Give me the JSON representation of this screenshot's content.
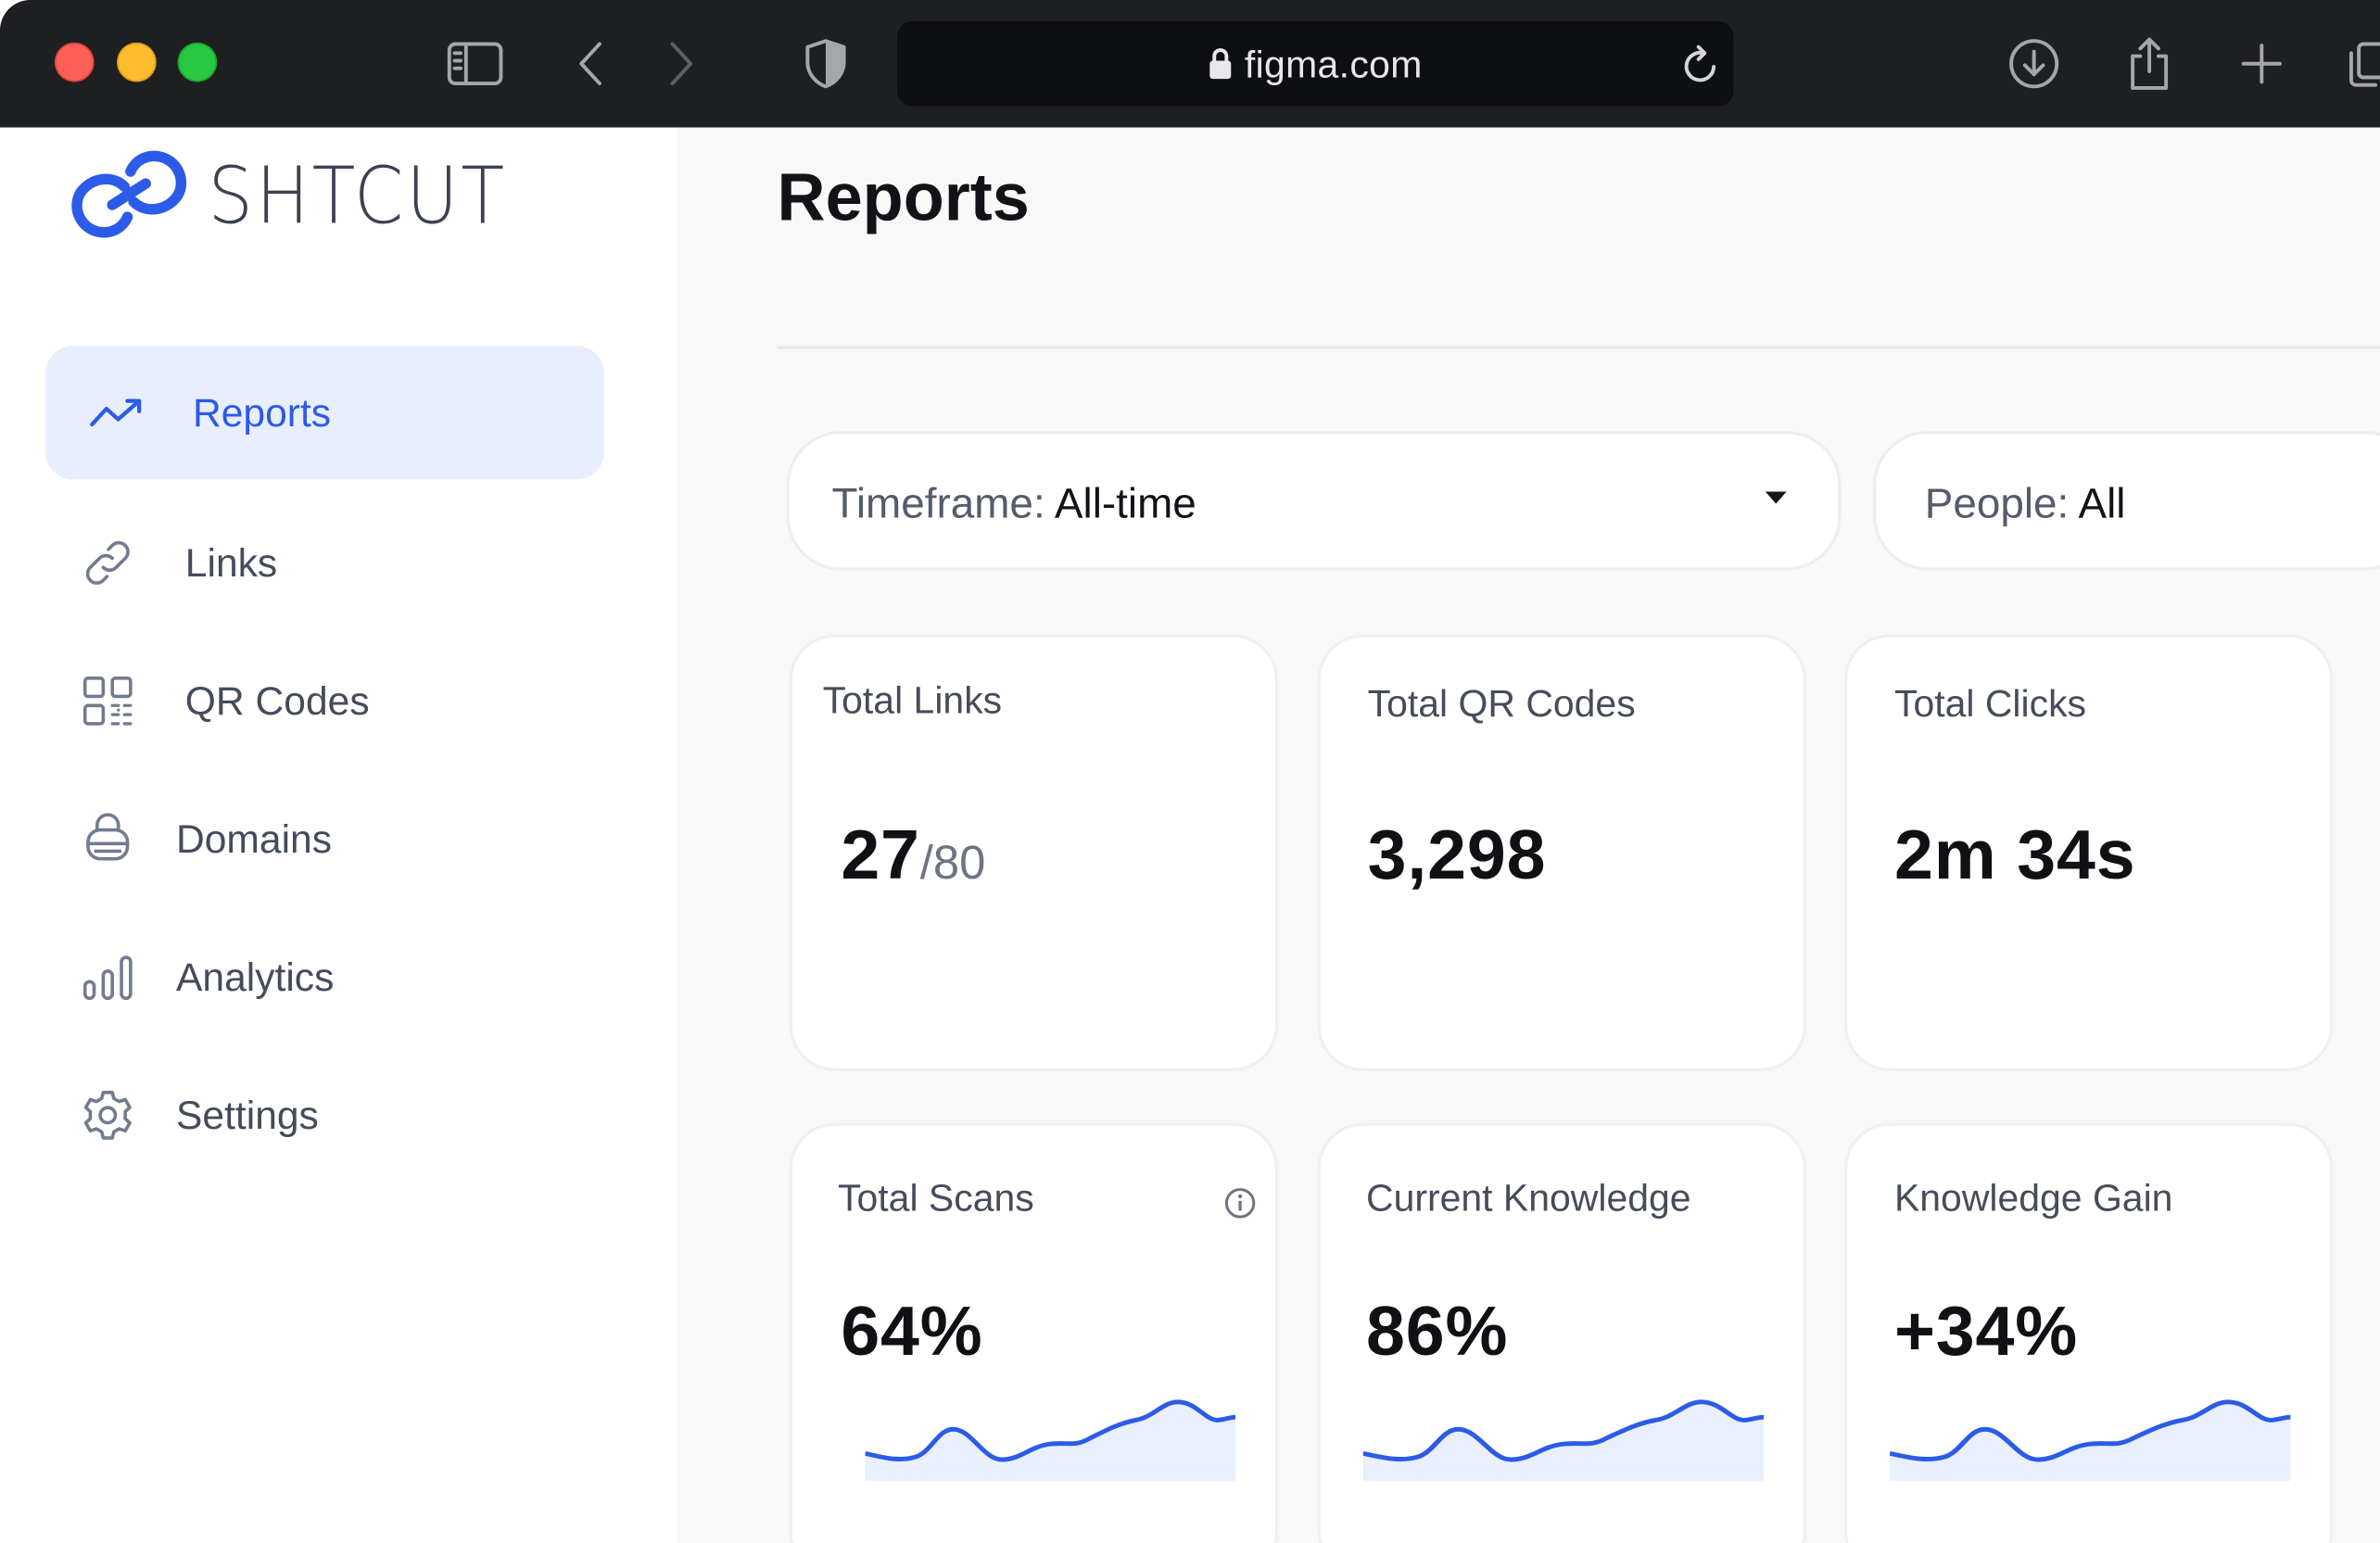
{
  "browser": {
    "url": "figma.com"
  },
  "app": {
    "brand": "SHTCUT",
    "accent_color": "#2c5be8"
  },
  "sidebar": {
    "items": [
      {
        "label": "Reports",
        "icon": "trending-up-icon",
        "active": true
      },
      {
        "label": "Links",
        "icon": "link-icon",
        "active": false
      },
      {
        "label": "QR Codes",
        "icon": "qr-code-icon",
        "active": false
      },
      {
        "label": "Domains",
        "icon": "domain-icon",
        "active": false
      },
      {
        "label": "Analytics",
        "icon": "bar-chart-icon",
        "active": false
      },
      {
        "label": "Settings",
        "icon": "gear-icon",
        "active": false
      }
    ]
  },
  "main": {
    "title": "Reports",
    "filters": [
      {
        "label": "Timeframe:",
        "value": "All-time"
      },
      {
        "label": "People:",
        "value": "All"
      }
    ],
    "stats": [
      {
        "title": "Total Links",
        "value": "27",
        "suffix": "/80"
      },
      {
        "title": "Total QR Codes",
        "value": "3,298"
      },
      {
        "title": "Total Clicks",
        "value": "2m 34s"
      }
    ],
    "kpis": [
      {
        "title": "Total Scans",
        "value": "64%",
        "has_info": true
      },
      {
        "title": "Current Knowledge",
        "value": "86%"
      },
      {
        "title": "Knowledge Gain",
        "value": "+34%"
      }
    ]
  }
}
